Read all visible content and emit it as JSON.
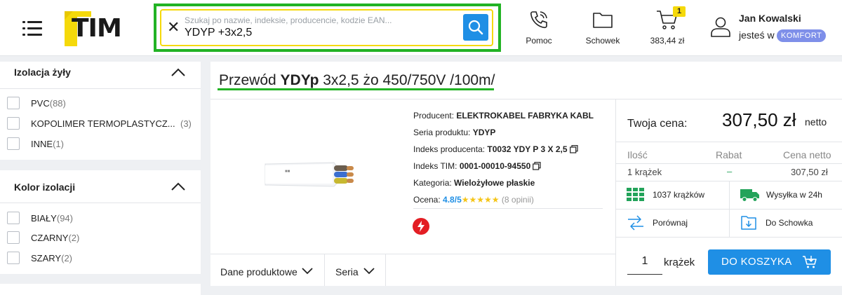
{
  "header": {
    "logo_text": "TIM",
    "search": {
      "placeholder": "Szukaj po nazwie, indeksie, producencie, kodzie EAN...",
      "value": "YDYP +3x2,5"
    },
    "help_label": "Pomoc",
    "clipboard_label": "Schowek",
    "cart": {
      "total": "383,44 zł",
      "count": "1"
    },
    "user": {
      "name": "Jan Kowalski",
      "status_prefix": "jesteś w",
      "tier": "KOMFORT"
    }
  },
  "filters": [
    {
      "title": "Izolacja żyły",
      "options": [
        {
          "label": "PVC",
          "count": "(88)"
        },
        {
          "label": "KOPOLIMER TERMOPLASTYCZ...",
          "count": "(3)"
        },
        {
          "label": "INNE",
          "count": "(1)"
        }
      ]
    },
    {
      "title": "Kolor izolacji",
      "options": [
        {
          "label": "BIAŁY",
          "count": "(94)"
        },
        {
          "label": "CZARNY",
          "count": "(2)"
        },
        {
          "label": "SZARY",
          "count": "(2)"
        }
      ]
    }
  ],
  "product": {
    "title_prefix": "Przewód ",
    "title_bold": "YDYp",
    "title_rest": " 3x2,5 żo 450/750V /100m/",
    "specs": {
      "producer_label": "Producent:",
      "producer": "ELEKTROKABEL FABRYKA KABL",
      "series_label": "Seria produktu:",
      "series": "YDYP",
      "producer_index_label": "Indeks producenta:",
      "producer_index": "T0032 YDY P 3 X 2,5",
      "tim_index_label": "Indeks TIM:",
      "tim_index": "0001-00010-94550",
      "category_label": "Kategoria:",
      "category": "Wielożyłowe płaskie",
      "rating_label": "Ocena:",
      "rating": "4.8/5",
      "stars": "★★★★★",
      "opinions": "(8 opinii)"
    },
    "tabs": [
      "Dane produktowe",
      "Seria"
    ]
  },
  "pricing": {
    "your_price_label": "Twoja cena:",
    "price": "307,50 zł",
    "netto_label": "netto",
    "table_headers": [
      "Ilość",
      "Rabat",
      "Cena netto"
    ],
    "row": {
      "qty": "1 krążek",
      "discount": "–",
      "net_price": "307,50 zł"
    },
    "features": {
      "stock": "1037 krążków",
      "shipping": "Wysyłka w 24h",
      "compare": "Porównaj",
      "to_clipboard": "Do Schowka"
    },
    "quantity": "1",
    "quantity_unit": "krążek",
    "add_to_cart": "DO KOSZYKA"
  },
  "colors": {
    "accent_blue": "#1f8fe5",
    "highlight_green": "#22b324",
    "brand_yellow": "#f5d90a",
    "tier_purple": "#7e8fe9",
    "bolt_red": "#e31e24"
  }
}
